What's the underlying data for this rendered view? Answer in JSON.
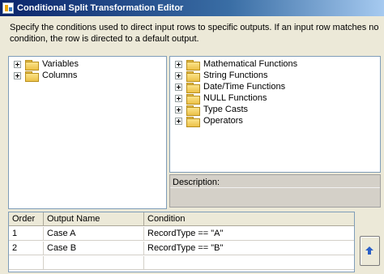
{
  "window": {
    "title": "Conditional Split Transformation Editor",
    "icon": "ssis-transform-icon"
  },
  "description_text": "Specify the conditions used to direct input rows to specific outputs. If an input row matches no condition, the row is directed to a default output.",
  "left_tree": {
    "items": [
      {
        "label": "Variables",
        "icon": "folder-icon"
      },
      {
        "label": "Columns",
        "icon": "folder-icon"
      }
    ]
  },
  "right_tree": {
    "items": [
      {
        "label": "Mathematical Functions",
        "icon": "folder-icon"
      },
      {
        "label": "String Functions",
        "icon": "folder-icon"
      },
      {
        "label": "Date/Time Functions",
        "icon": "folder-icon"
      },
      {
        "label": "NULL Functions",
        "icon": "folder-icon"
      },
      {
        "label": "Type Casts",
        "icon": "folder-icon"
      },
      {
        "label": "Operators",
        "icon": "folder-icon"
      }
    ]
  },
  "description_panel": {
    "label": "Description:"
  },
  "grid": {
    "columns": [
      "Order",
      "Output Name",
      "Condition"
    ],
    "rows": [
      {
        "order": "1",
        "output_name": "Case A",
        "condition": "RecordType == \"A\""
      },
      {
        "order": "2",
        "output_name": "Case B",
        "condition": "RecordType == \"B\""
      }
    ]
  },
  "buttons": {
    "move_up_icon": "arrow-up-icon"
  }
}
